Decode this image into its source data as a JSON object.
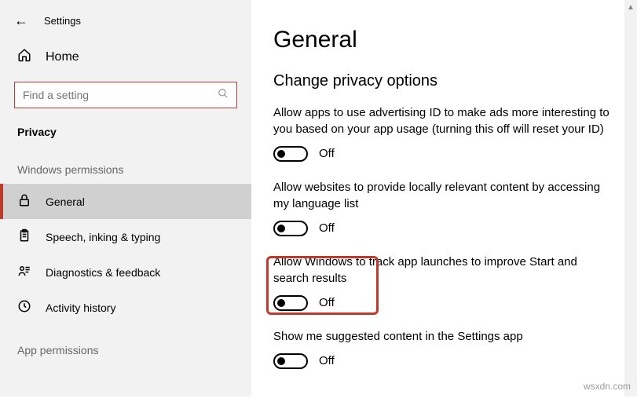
{
  "header": {
    "back_label": "Settings"
  },
  "sidebar": {
    "home_label": "Home",
    "search_placeholder": "Find a setting",
    "category_label": "Privacy",
    "section1_label": "Windows permissions",
    "items": [
      {
        "label": "General"
      },
      {
        "label": "Speech, inking & typing"
      },
      {
        "label": "Diagnostics & feedback"
      },
      {
        "label": "Activity history"
      }
    ],
    "section2_label": "App permissions"
  },
  "main": {
    "title": "General",
    "subtitle": "Change privacy options",
    "options": [
      {
        "text": "Allow apps to use advertising ID to make ads more interesting to you based on your app usage (turning this off will reset your ID)",
        "state": "Off"
      },
      {
        "text": "Allow websites to provide locally relevant content by accessing my language list",
        "state": "Off"
      },
      {
        "text": "Allow Windows to track app launches to improve Start and search results",
        "state": "Off"
      },
      {
        "text": "Show me suggested content in the Settings app",
        "state": "Off"
      }
    ]
  },
  "watermark": "wsxdn.com"
}
